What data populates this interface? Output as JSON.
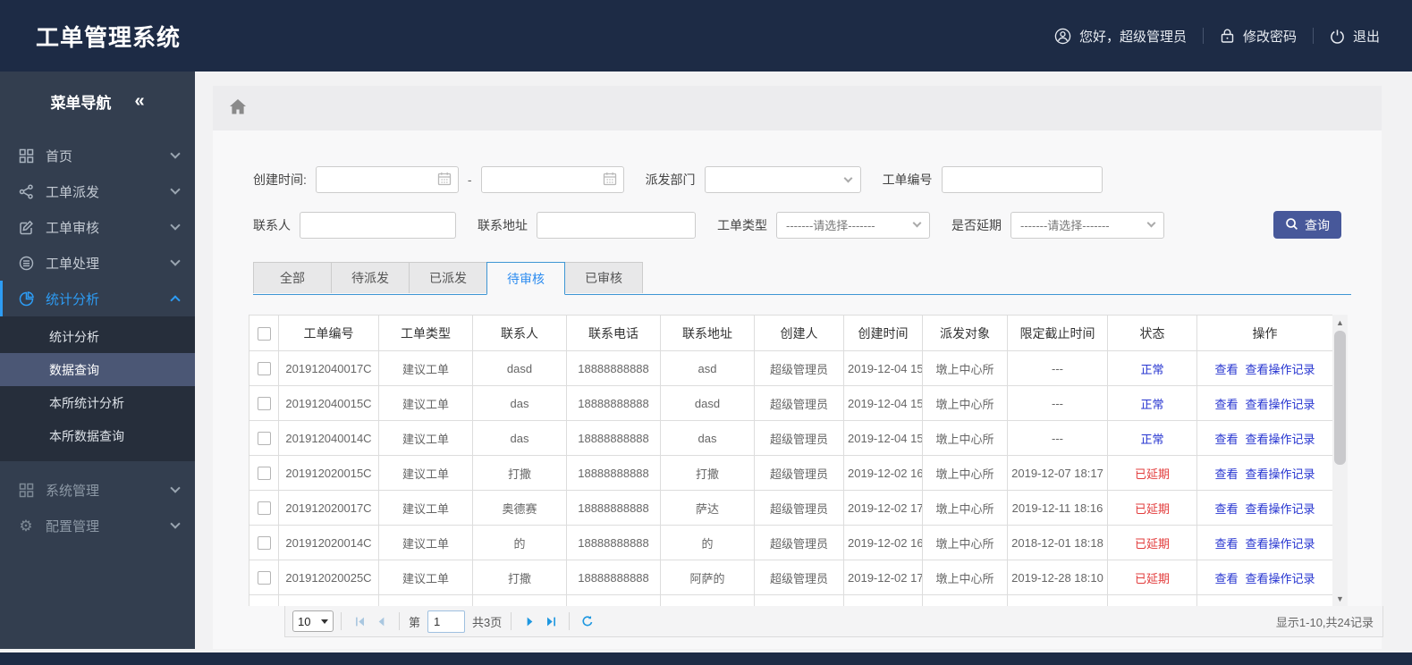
{
  "header": {
    "title": "工单管理系统",
    "user_greeting": "您好，超级管理员",
    "change_password": "修改密码",
    "logout": "退出"
  },
  "icons": {
    "collapse": "«",
    "gear": "⚙",
    "scroll_up": "▲",
    "scroll_down": "▼"
  },
  "sidebar": {
    "title": "菜单导航",
    "menu": [
      {
        "label": "首页"
      },
      {
        "label": "工单派发"
      },
      {
        "label": "工单审核"
      },
      {
        "label": "工单处理"
      },
      {
        "label": "统计分析"
      },
      {
        "label": "系统管理"
      },
      {
        "label": "配置管理"
      }
    ],
    "submenu": [
      {
        "label": "统计分析"
      },
      {
        "label": "数据查询"
      },
      {
        "label": "本所统计分析"
      },
      {
        "label": "本所数据查询"
      }
    ]
  },
  "filters": {
    "create_time_label": "创建时间:",
    "date_separator": "-",
    "dispatch_dept_label": "派发部门",
    "order_no_label": "工单编号",
    "contact_label": "联系人",
    "address_label": "联系地址",
    "order_type_label": "工单类型",
    "is_delay_label": "是否延期",
    "select_placeholder": "-------请选择-------",
    "search_button": "查询"
  },
  "tabs": [
    {
      "label": "全部"
    },
    {
      "label": "待派发"
    },
    {
      "label": "已派发"
    },
    {
      "label": "待审核"
    },
    {
      "label": "已审核"
    }
  ],
  "table": {
    "columns": [
      "工单编号",
      "工单类型",
      "联系人",
      "联系电话",
      "联系地址",
      "创建人",
      "创建时间",
      "派发对象",
      "限定截止时间",
      "状态",
      "操作"
    ],
    "view_label": "查看",
    "view_log_label": "查看操作记录",
    "rows": [
      {
        "no": "201912040017C",
        "type": "建议工单",
        "contact": "dasd",
        "phone": "18888888888",
        "address": "asd",
        "creator": "超级管理员",
        "created": "2019-12-04 15",
        "target": "墩上中心所",
        "deadline": "---",
        "status": "正常"
      },
      {
        "no": "201912040015C",
        "type": "建议工单",
        "contact": "das",
        "phone": "18888888888",
        "address": "dasd",
        "creator": "超级管理员",
        "created": "2019-12-04 15",
        "target": "墩上中心所",
        "deadline": "---",
        "status": "正常"
      },
      {
        "no": "201912040014C",
        "type": "建议工单",
        "contact": "das",
        "phone": "18888888888",
        "address": "das",
        "creator": "超级管理员",
        "created": "2019-12-04 15",
        "target": "墩上中心所",
        "deadline": "---",
        "status": "正常"
      },
      {
        "no": "201912020015C",
        "type": "建议工单",
        "contact": "打撒",
        "phone": "18888888888",
        "address": "打撒",
        "creator": "超级管理员",
        "created": "2019-12-02 16",
        "target": "墩上中心所",
        "deadline": "2019-12-07 18:17",
        "status": "已延期"
      },
      {
        "no": "201912020017C",
        "type": "建议工单",
        "contact": "奥德赛",
        "phone": "18888888888",
        "address": "萨达",
        "creator": "超级管理员",
        "created": "2019-12-02 17",
        "target": "墩上中心所",
        "deadline": "2019-12-11 18:16",
        "status": "已延期"
      },
      {
        "no": "201912020014C",
        "type": "建议工单",
        "contact": "的",
        "phone": "18888888888",
        "address": "的",
        "creator": "超级管理员",
        "created": "2019-12-02 16",
        "target": "墩上中心所",
        "deadline": "2018-12-01 18:18",
        "status": "已延期"
      },
      {
        "no": "201912020025C",
        "type": "建议工单",
        "contact": "打撒",
        "phone": "18888888888",
        "address": "阿萨的",
        "creator": "超级管理员",
        "created": "2019-12-02 17",
        "target": "墩上中心所",
        "deadline": "2019-12-28 18:10",
        "status": "已延期"
      }
    ]
  },
  "pagination": {
    "page_size": "10",
    "page_prefix": "第",
    "current_page": "1",
    "total_pages": "共3页",
    "summary": "显示1-10,共24记录"
  }
}
